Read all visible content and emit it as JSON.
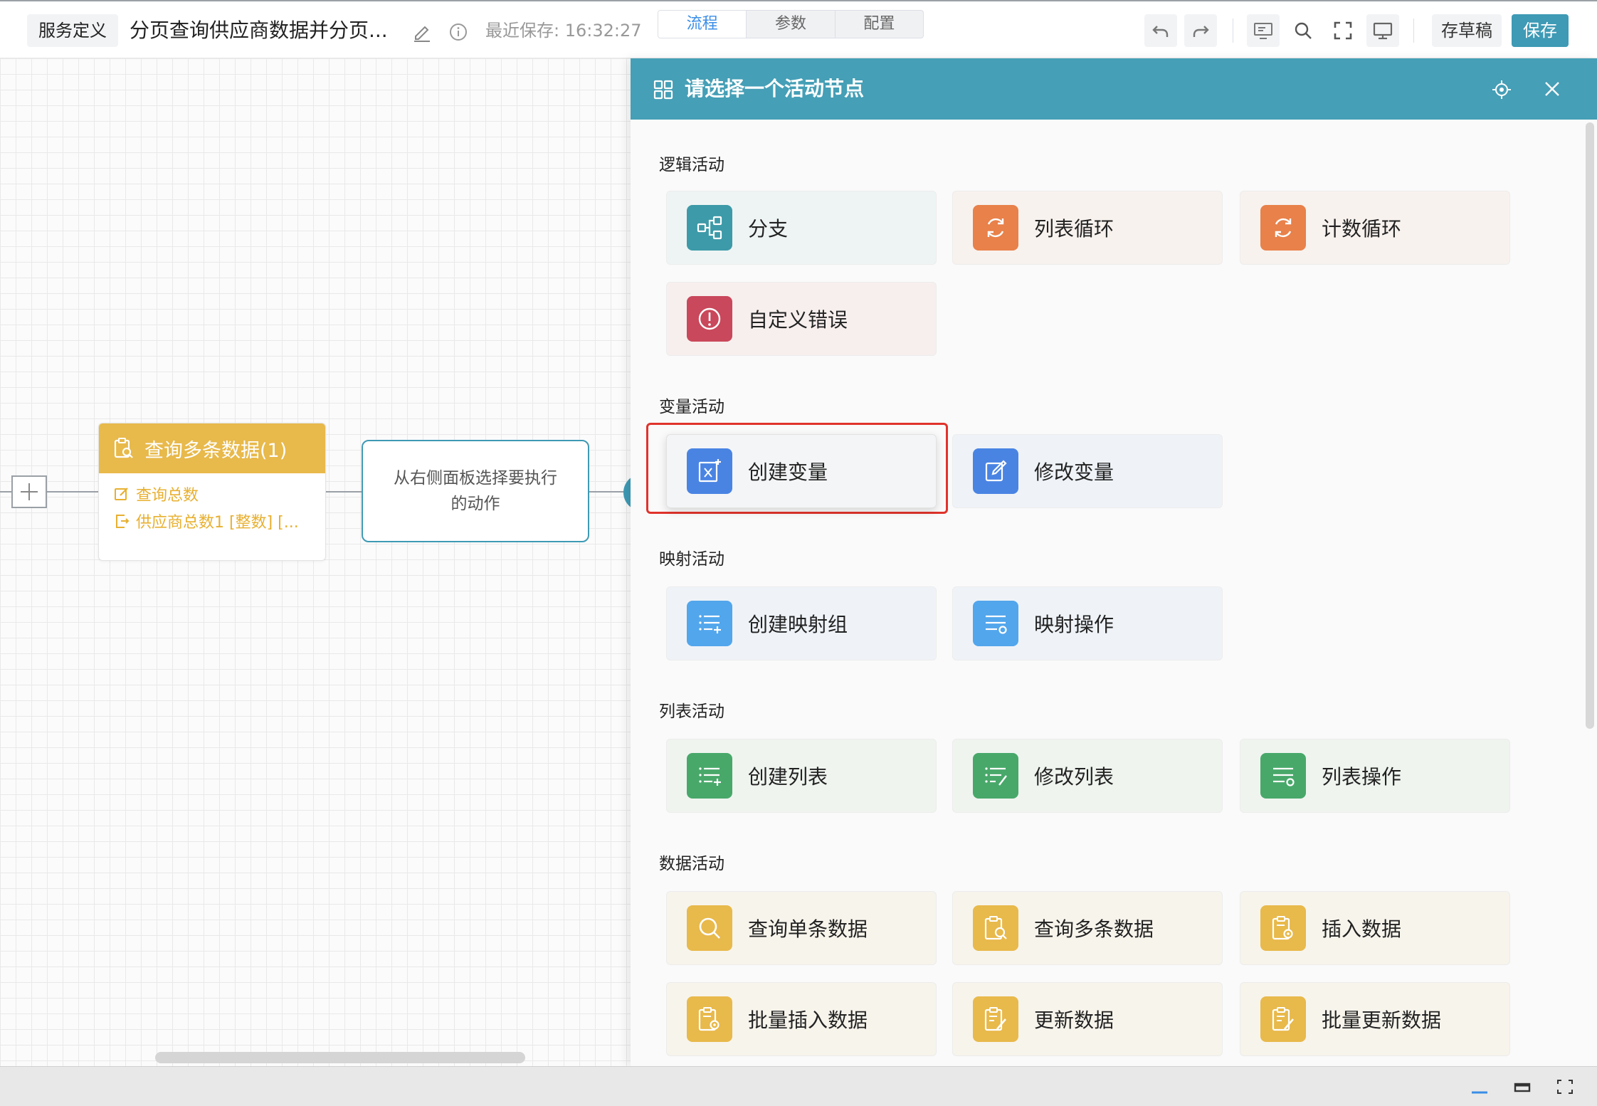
{
  "header": {
    "service_label": "服务定义",
    "flow_title": "分页查询供应商数据并分页...",
    "saved_text": "最近保存: 16:32:27",
    "tabs": [
      {
        "label": "流程",
        "active": true
      },
      {
        "label": "参数",
        "active": false
      },
      {
        "label": "配置",
        "active": false
      }
    ],
    "draft_label": "存草稿",
    "save_label": "保存",
    "toolbar_icons": [
      "undo-icon",
      "redo-icon",
      "monitor-settings-icon",
      "search-icon",
      "fullscreen-icon",
      "desktop-icon"
    ]
  },
  "canvas": {
    "query_node": {
      "title": "查询多条数据(1)",
      "lines": [
        "查询总数",
        "供应商总数1 [整数] [..."
      ]
    },
    "action_node": {
      "text": "从右侧面板选择要执行的动作"
    }
  },
  "panel": {
    "title": "请选择一个活动节点",
    "sections": [
      {
        "title": "逻辑活动",
        "items": [
          "分支",
          "列表循环",
          "计数循环",
          "自定义错误"
        ]
      },
      {
        "title": "变量活动",
        "items": [
          "创建变量",
          "修改变量"
        ]
      },
      {
        "title": "映射活动",
        "items": [
          "创建映射组",
          "映射操作"
        ]
      },
      {
        "title": "列表活动",
        "items": [
          "创建列表",
          "修改列表",
          "列表操作"
        ]
      },
      {
        "title": "数据活动",
        "items": [
          "查询单条数据",
          "查询多条数据",
          "插入数据",
          "批量插入数据",
          "更新数据",
          "批量更新数据"
        ]
      }
    ],
    "selected_item": "创建变量"
  },
  "colors": {
    "accent": "#459fb6",
    "highlight": "#e0332b",
    "node_yellow": "#e8b94b"
  }
}
